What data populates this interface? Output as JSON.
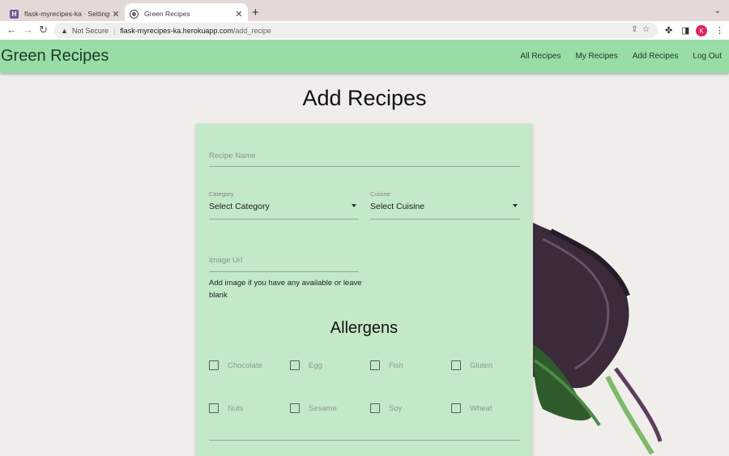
{
  "browser": {
    "tabs": [
      {
        "title": "flask-myrecipes-ka · Settings |",
        "active": false
      },
      {
        "title": "Green Recipes",
        "active": true
      }
    ],
    "new_tab": "+",
    "url_security": "Not Secure",
    "url_host": "flask-myrecipes-ka.herokuapp.com",
    "url_path": "/add_recipe",
    "profile_initial": "K"
  },
  "navbar": {
    "brand": "Green Recipes",
    "links": [
      "All Recipes",
      "My Recipes",
      "Add Recipes",
      "Log Out"
    ],
    "color": "#98dda6"
  },
  "main": {
    "heading": "Add Recipes",
    "form": {
      "recipe_name_placeholder": "Recipe Name",
      "category_label": "Category",
      "category_value": "Select Category",
      "cuisine_label": "Cuisine",
      "cuisine_value": "Select Cuisine",
      "image_url_placeholder": "Image Url",
      "image_helper": "Add image if you have any available or leave blank",
      "allergens_title": "Allergens",
      "allergens": [
        "Chocolate",
        "Egg",
        "Fish",
        "Gluten",
        "Nuts",
        "Sesame",
        "Soy",
        "Wheat"
      ]
    },
    "card_color": "#c3e9c8"
  }
}
